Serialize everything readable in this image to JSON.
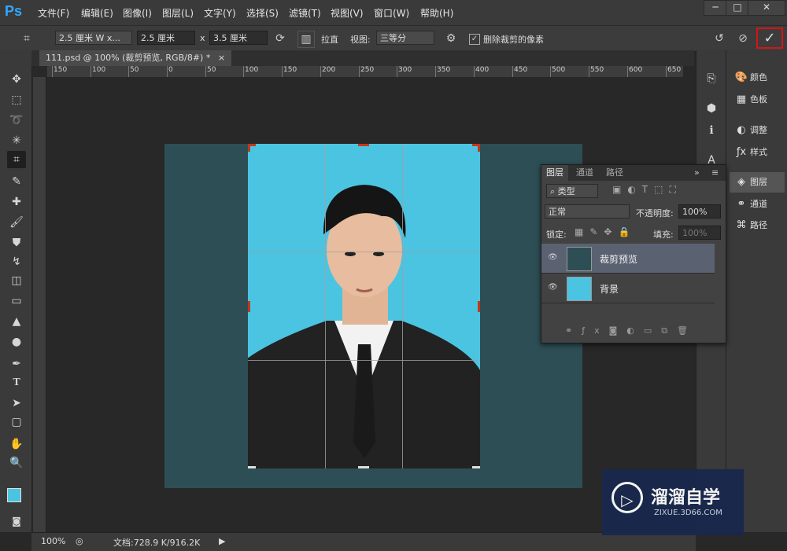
{
  "app": {
    "logo": "Ps"
  },
  "menu": [
    "文件(F)",
    "编辑(E)",
    "图像(I)",
    "图层(L)",
    "文字(Y)",
    "选择(S)",
    "滤镜(T)",
    "视图(V)",
    "窗口(W)",
    "帮助(H)"
  ],
  "window_controls": {
    "minimize": "─",
    "maximize": "□",
    "close": "✕"
  },
  "options": {
    "preset": "2.5 厘米 W x...",
    "width": "2.5 厘米",
    "times": "x",
    "height": "3.5 厘米",
    "straighten": "拉直",
    "view_label": "视图:",
    "view_value": "三等分",
    "delete_pixels": "删除裁剪的像素",
    "delete_pixels_checked": true
  },
  "document": {
    "tab_title": "111.psd @ 100% (裁剪预览, RGB/8#) *",
    "close": "×"
  },
  "ruler": {
    "ticks": [
      "150",
      "100",
      "50",
      "0",
      "50",
      "100",
      "150",
      "200",
      "250",
      "300",
      "350",
      "400",
      "450",
      "500",
      "550",
      "600",
      "650"
    ]
  },
  "right_panels": [
    {
      "label": "颜色",
      "icon": "palette-icon"
    },
    {
      "label": "色板",
      "icon": "swatches-icon"
    },
    {
      "label": "调整",
      "icon": "adjustments-icon"
    },
    {
      "label": "样式",
      "icon": "styles-icon"
    },
    {
      "label": "图层",
      "icon": "layers-icon",
      "active": true
    },
    {
      "label": "通道",
      "icon": "channels-icon"
    },
    {
      "label": "路径",
      "icon": "paths-icon"
    }
  ],
  "layers_panel": {
    "tabs": [
      "图层",
      "通道",
      "路径"
    ],
    "filter_type": "类型",
    "blend_mode": "正常",
    "opacity_label": "不透明度:",
    "opacity_value": "100%",
    "lock_label": "锁定:",
    "fill_label": "填充:",
    "fill_value": "100%",
    "layers": [
      {
        "name": "裁剪预览",
        "active": true
      },
      {
        "name": "背景",
        "active": false
      }
    ]
  },
  "status": {
    "zoom": "100%",
    "doc_info": "文档:728.9 K/916.2K"
  },
  "watermark": {
    "brand": "溜溜自学",
    "url": "ZIXUE.3D66.COM"
  },
  "colors": {
    "accent": "#31a8ff",
    "commit_border": "#d41515",
    "crop_bg": "#4bc4e2",
    "outer_bg": "#2d4e55"
  }
}
